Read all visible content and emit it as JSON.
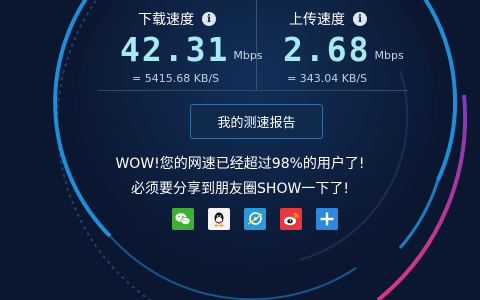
{
  "download": {
    "label": "下载速度",
    "value": "42.31",
    "unit": "Mbps",
    "sub": "= 5415.68  KB/S"
  },
  "upload": {
    "label": "上传速度",
    "value": "2.68",
    "unit": "Mbps",
    "sub": "= 343.04  KB/S"
  },
  "info_icon_glyph": "i",
  "report_button": "我的测速报告",
  "message": {
    "line1": "WOW!您的网速已经超过98%的用户了!",
    "line2": "必须要分享到朋友圈SHOW一下了!"
  },
  "share": [
    {
      "name": "wechat-icon",
      "color": "#3fb035"
    },
    {
      "name": "qq-icon",
      "color": "#f4f4f4"
    },
    {
      "name": "qzone-icon",
      "color": "#2b9ad9"
    },
    {
      "name": "weibo-icon",
      "color": "#e8383d"
    },
    {
      "name": "plus-icon",
      "color": "#2e86de"
    }
  ],
  "colors": {
    "background": "#0b1630",
    "gauge_blue": "#1e90d6",
    "gauge_pink": "#d9368b",
    "value_text": "#a6eaf3"
  }
}
